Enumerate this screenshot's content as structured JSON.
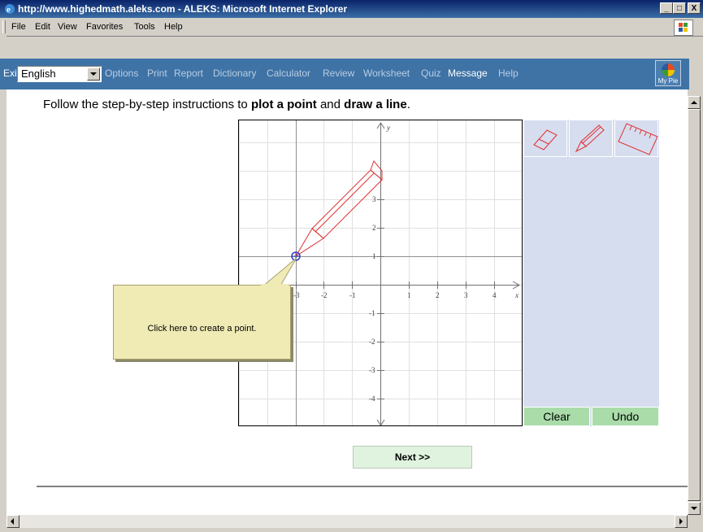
{
  "window": {
    "title": "http://www.highedmath.aleks.com - ALEKS: Microsoft Internet Explorer",
    "controls": [
      "_",
      "□",
      "X"
    ]
  },
  "menubar": {
    "items": [
      "File",
      "Edit",
      "View",
      "Favorites",
      "Tools",
      "Help"
    ]
  },
  "toolbar": {
    "exit_label": "Exit",
    "language_value": "English",
    "links": [
      "Options",
      "Print",
      "Report",
      "Dictionary",
      "Calculator",
      "Review",
      "Worksheet",
      "Quiz",
      "Message",
      "Help"
    ],
    "mypie_label": "My Pie",
    "colors": {
      "bar": "#3f73a6",
      "link": "#b8cde3"
    }
  },
  "instruction": {
    "prefix": "Follow the step-by-step instructions to ",
    "bold1": "plot a point",
    "middle": " and ",
    "bold2": "draw a line",
    "suffix": "."
  },
  "graph": {
    "x_axis_label": "x",
    "y_axis_label": "y",
    "x_tick_labels": [
      "-3",
      "-2",
      "-1",
      "1",
      "2",
      "3",
      "4"
    ],
    "y_tick_labels": [
      "3",
      "2",
      "1",
      "-1",
      "-2",
      "-3",
      "-4"
    ],
    "cursor_point": {
      "x": -3,
      "y": 1
    }
  },
  "tools": {
    "eraser_icon": "eraser-icon",
    "pencil_icon": "pencil-icon",
    "ruler_icon": "ruler-icon",
    "clear_label": "Clear",
    "undo_label": "Undo"
  },
  "callout": {
    "text": "Click here to create a point."
  },
  "next_button": {
    "label": "Next >>"
  }
}
